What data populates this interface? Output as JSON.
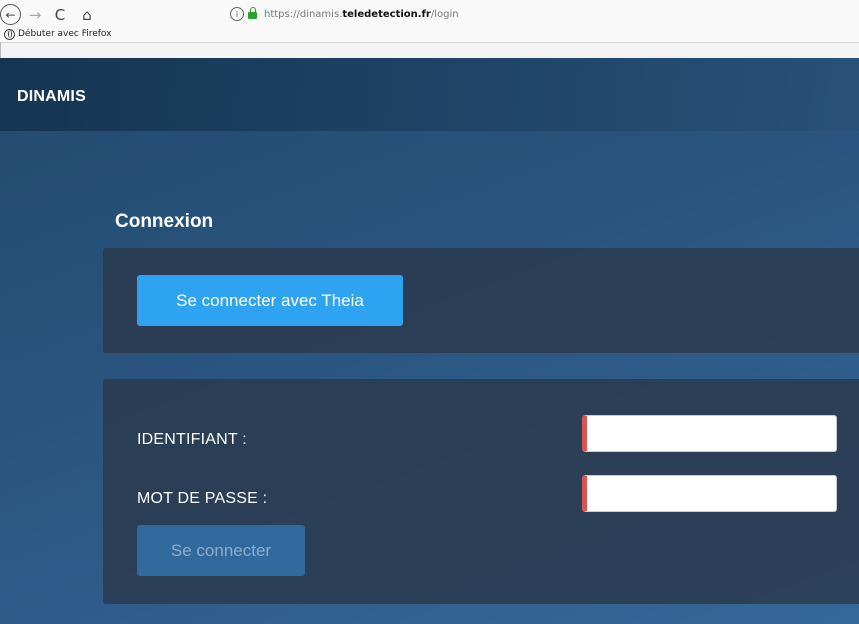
{
  "browser": {
    "back_icon": "←",
    "forward_icon": "→",
    "reload_icon": "C",
    "home_icon": "⌂",
    "info_icon": "i",
    "url_prefix": "https://dinamis.",
    "url_host": "teledetection.fr",
    "url_suffix": "/login",
    "bookmark_label": "Débuter avec Firefox"
  },
  "header": {
    "brand": "DINAMIS"
  },
  "login": {
    "title": "Connexion",
    "theia_button": "Se connecter avec Theia",
    "username_label": "IDENTIFIANT :",
    "password_label": "MOT DE PASSE :",
    "username_value": "",
    "password_value": "",
    "submit_button": "Se connecter"
  },
  "colors": {
    "accent": "#2ea3f2",
    "required_marker": "#d9534f",
    "background": "#2a5580"
  }
}
